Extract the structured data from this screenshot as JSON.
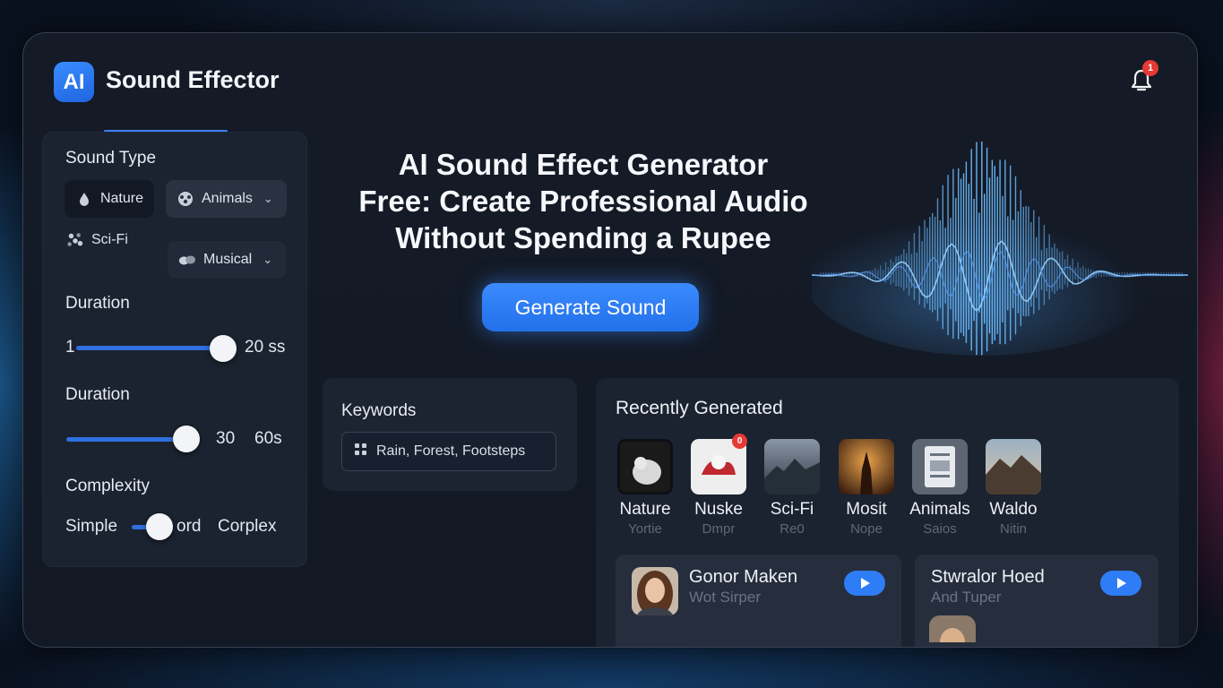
{
  "app": {
    "logo_text": "AI",
    "title": "Sound Effector"
  },
  "header": {
    "notification_count": "1"
  },
  "sidebar": {
    "sound_type_label": "Sound Type",
    "sound_types": [
      {
        "label": "Nature",
        "icon": "droplet-icon"
      },
      {
        "label": "Animals",
        "icon": "paw-icon",
        "has_dropdown": true
      },
      {
        "label": "Sci-Fi",
        "icon": "dots-cluster-icon"
      },
      {
        "label": "Musical",
        "icon": "music-icon",
        "has_dropdown": true
      }
    ],
    "duration1": {
      "label": "Duration",
      "min_text": "1",
      "max_text": "20 ss",
      "value_fraction": 0.95
    },
    "duration2": {
      "label": "Duration",
      "value_text": "30",
      "max_text": "60s",
      "value_fraction": 0.9
    },
    "complexity": {
      "label": "Complexity",
      "left_text": "Simple",
      "mid_text": "ord",
      "right_text": "Corplex",
      "value_fraction": 0.6
    }
  },
  "hero": {
    "title_line1": "AI Sound Effect Generator",
    "title_line2": "Free: Create Professional Audio",
    "title_line3": "Without Spending a Rupee",
    "generate_label": "Generate Sound"
  },
  "keywords": {
    "label": "Keywords",
    "value": "Rain, Forest, Footsteps"
  },
  "recent": {
    "title": "Recently Generated",
    "items": [
      {
        "label": "Nature",
        "sub": "Yortie"
      },
      {
        "label": "Nuske",
        "sub": "Dmpr",
        "badge": "0"
      },
      {
        "label": "Sci-Fi",
        "sub": "Re0"
      },
      {
        "label": "Mosit",
        "sub": "Nope"
      },
      {
        "label": "Animals",
        "sub": "Saios"
      },
      {
        "label": "Waldo",
        "sub": "Nitin"
      }
    ],
    "tracks": [
      {
        "name": "Gonor Maken",
        "sub": "Wot Sirper"
      },
      {
        "name": "Stwralor Hoed",
        "sub": "And Tuper"
      }
    ]
  },
  "colors": {
    "accent": "#2e7cf6",
    "badge": "#e53935",
    "panel": "#1b2230"
  }
}
